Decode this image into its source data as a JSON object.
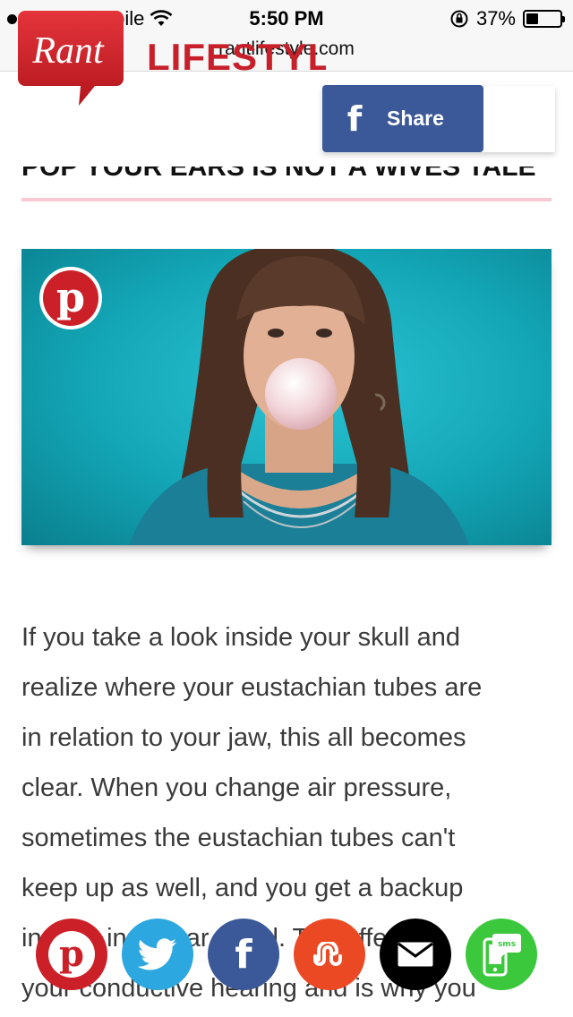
{
  "status_bar": {
    "carrier": "T-Mobile",
    "time": "5:50 PM",
    "battery": "37%",
    "battery_level": 0.37,
    "signal_bars_filled": 2,
    "signal_bars_total": 5
  },
  "browser": {
    "url": "rantlifestyle.com"
  },
  "header": {
    "logo_text": "Rant",
    "site_name": "LIFESTYLE",
    "share_button": {
      "icon": "facebook-icon",
      "label": "Share",
      "color": "#3b5998"
    }
  },
  "article": {
    "title_partial": "POP YOUR EARS IS NOT A WIVES TALE",
    "title_rule_color": "#f8c9d2",
    "hero_image": {
      "pin_icon": "pinterest-icon"
    },
    "body_lines": [
      "If you take a look inside your skull and",
      "realize where your eustachian tubes are",
      "in relation to your jaw, this all becomes",
      "clear. When you change air pressure,",
      "sometimes the eustachian tubes can't",
      "keep up as well, and you get a backup",
      "in your inner ear canal. The effect of",
      "your conductive hearing and is why you"
    ]
  },
  "social_bar": {
    "buttons": [
      {
        "name": "pinterest",
        "icon": "pinterest-icon",
        "color": "#cb2027"
      },
      {
        "name": "twitter",
        "icon": "twitter-bird-icon",
        "color": "#2ca7e0"
      },
      {
        "name": "facebook",
        "icon": "facebook-icon",
        "color": "#3b5998"
      },
      {
        "name": "stumbleupon",
        "icon": "stumbleupon-icon",
        "color": "#eb4924"
      },
      {
        "name": "email",
        "icon": "envelope-icon",
        "color": "#000000"
      },
      {
        "name": "sms",
        "icon": "sms-phone-icon",
        "color": "#3cc83c",
        "label": "sms"
      }
    ]
  }
}
